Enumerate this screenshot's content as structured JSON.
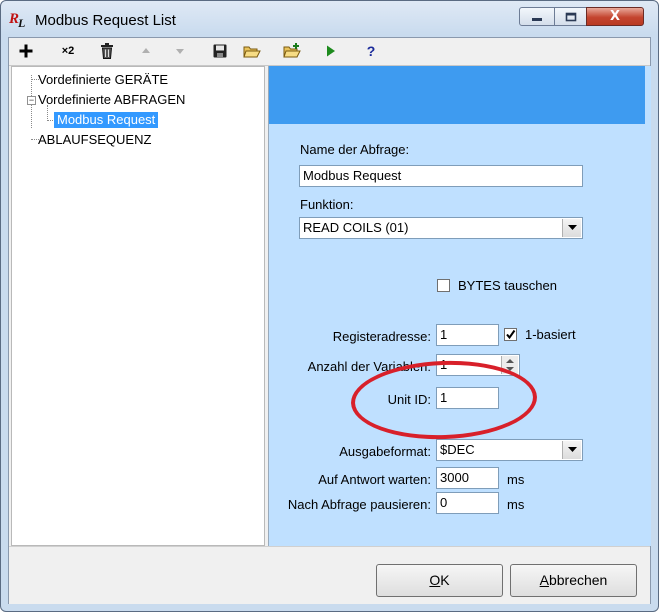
{
  "window": {
    "title": "Modbus Request List",
    "close_glyph": "X"
  },
  "toolbar": {
    "buttons": [
      {
        "icon": "add-icon"
      },
      {
        "icon": "duplicate-x2-icon",
        "label": "×2"
      },
      {
        "icon": "delete-icon"
      },
      {
        "icon": "move-up-icon"
      },
      {
        "icon": "move-down-icon"
      },
      {
        "icon": "save-icon"
      },
      {
        "icon": "open-folder-icon"
      },
      {
        "icon": "new-folder-icon"
      },
      {
        "icon": "run-icon"
      },
      {
        "icon": "help-icon",
        "label": "?"
      }
    ]
  },
  "tree": {
    "items": [
      {
        "label": "Vordefinierte GERÄTE"
      },
      {
        "label": "Vordefinierte ABFRAGEN",
        "expander": "−"
      },
      {
        "label": "Modbus Request",
        "selected": true
      },
      {
        "label": "ABLAUFSEQUENZ"
      }
    ]
  },
  "form": {
    "name_label": "Name der Abfrage:",
    "name_value": "Modbus Request",
    "function_label": "Funktion:",
    "function_value": "READ COILS (01)",
    "swap_bytes_label": "BYTES tauschen",
    "swap_bytes_checked": false,
    "register_label": "Registeradresse:",
    "register_value": "1",
    "one_based_label": "1-basiert",
    "one_based_checked": true,
    "var_count_label": "Anzahl der Variablen:",
    "var_count_value": "1",
    "unit_id_label": "Unit ID:",
    "unit_id_value": "1",
    "output_format_label": "Ausgabeformat:",
    "output_format_value": "$DEC",
    "wait_label": "Auf Antwort warten:",
    "wait_value": "3000",
    "wait_unit": "ms",
    "pause_label": "Nach Abfrage pausieren:",
    "pause_value": "0",
    "pause_unit": "ms"
  },
  "buttons": {
    "ok": {
      "prefix": "",
      "accel": "O",
      "rest": "K"
    },
    "cancel": {
      "prefix": "",
      "accel": "A",
      "rest": "bbrechen"
    }
  },
  "colors": {
    "panel_background": "#bfe0ff",
    "panel_header": "#3e9bf0",
    "selection": "#3399ff",
    "annotation_oval": "#d8202a"
  }
}
